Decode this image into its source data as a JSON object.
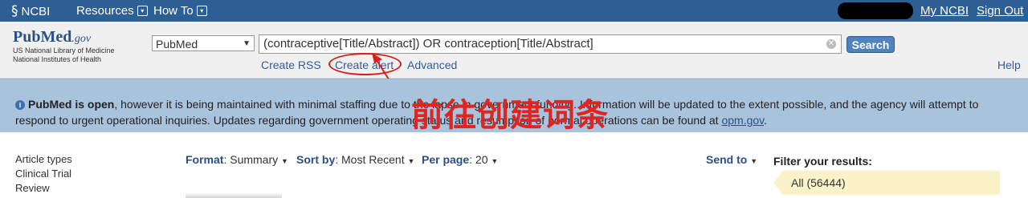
{
  "topbar": {
    "ncbi": "NCBI",
    "resources": "Resources",
    "howto": "How To",
    "mynbi": "My NCBI",
    "signout": "Sign Out",
    "dropdown_icon": "⊙"
  },
  "logo": {
    "word": "PubMed",
    "gov": ".gov",
    "line1": "US National Library of Medicine",
    "line2": "National Institutes of Health"
  },
  "search": {
    "db": "PubMed",
    "query": "(contraceptive[Title/Abstract]) OR contraception[Title/Abstract]",
    "button": "Search",
    "rss": "Create RSS",
    "alert": "Create alert",
    "advanced": "Advanced",
    "help": "Help"
  },
  "banner": {
    "bold": "PubMed is open",
    "line1": ", however it is being maintained with minimal staffing due to the lapse in government funding. Information will be updated to the extent possible, and the agency will attempt to",
    "line2": "respond to urgent operational inquiries. Updates regarding government operating status and resumption of normal operations can be found at ",
    "link": "opm.gov",
    "end": "."
  },
  "annotation": "前往创建词条",
  "sidebar": {
    "heading": "Article types",
    "items": [
      "Clinical Trial",
      "Review"
    ]
  },
  "toolbar": {
    "format_label": "Format",
    "format_value": "Summary",
    "sort_label": "Sort by",
    "sort_value": "Most Recent",
    "perpage_label": "Per page",
    "perpage_value": "20",
    "sendto": "Send to"
  },
  "filter": {
    "title": "Filter your results:",
    "all": "All (56444)"
  },
  "colors": {
    "topbar": "#2e5f94",
    "banner": "#a9c3dc",
    "annotation": "#e0241f"
  }
}
